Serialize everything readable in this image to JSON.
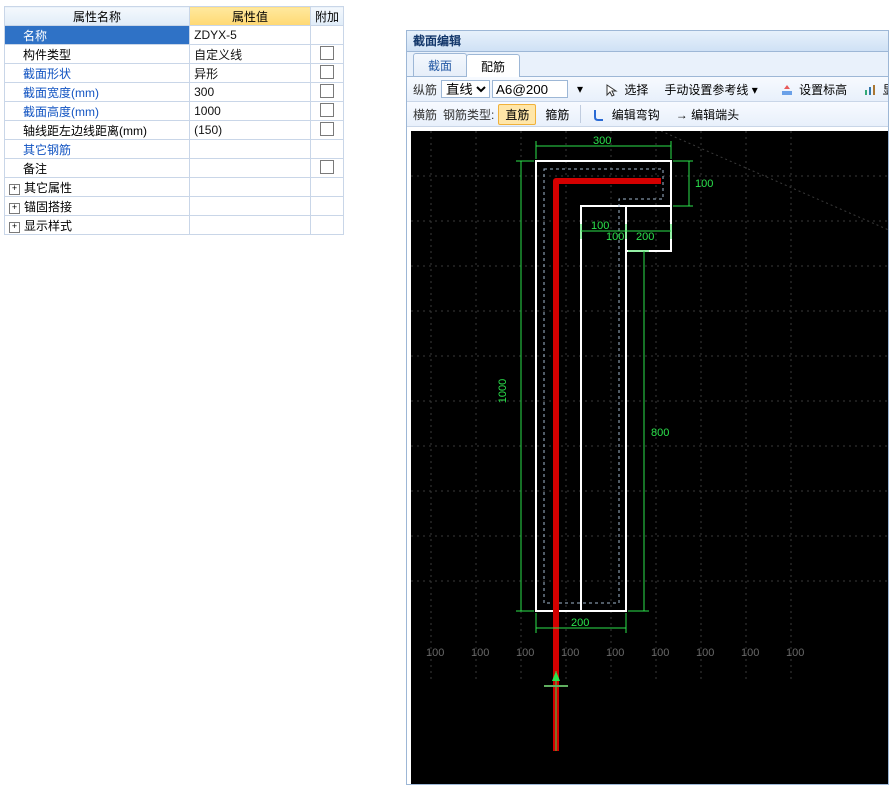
{
  "propgrid": {
    "headers": {
      "name": "属性名称",
      "value": "属性值",
      "extra": "附加"
    },
    "rows": [
      {
        "key": "name",
        "label": "名称",
        "value": "ZDYX-5",
        "selected": true,
        "extra": null
      },
      {
        "key": "type",
        "label": "构件类型",
        "value": "自定义线",
        "extra": "chk"
      },
      {
        "key": "shape",
        "label": "截面形状",
        "value": "异形",
        "blue": true,
        "extra": "chk"
      },
      {
        "key": "width",
        "label": "截面宽度(mm)",
        "value": "300",
        "blue": true,
        "extra": "chk"
      },
      {
        "key": "height",
        "label": "截面高度(mm)",
        "value": "1000",
        "blue": true,
        "extra": "chk"
      },
      {
        "key": "axis",
        "label": "轴线距左边线距离(mm)",
        "value": "(150)",
        "extra": "chk"
      },
      {
        "key": "other_rebar",
        "label": "其它钢筋",
        "value": "",
        "blue": true,
        "extra": null
      },
      {
        "key": "remark",
        "label": "备注",
        "value": "",
        "extra": "chk"
      },
      {
        "key": "exp1",
        "label": "其它属性",
        "value": "",
        "expander": true
      },
      {
        "key": "exp2",
        "label": "锚固搭接",
        "value": "",
        "expander": true
      },
      {
        "key": "exp3",
        "label": "显示样式",
        "value": "",
        "expander": true
      }
    ],
    "plus": "+"
  },
  "editor": {
    "title": "截面编辑",
    "tabs": {
      "section": "截面",
      "rebar": "配筋"
    },
    "toolbar1": {
      "label_v": "纵筋",
      "line_type": "直线",
      "spec": "A6@200",
      "select_btn": "选择",
      "manual_ref": "手动设置参考线",
      "set_elev": "设置标高",
      "show_label": "显示标"
    },
    "toolbar2": {
      "label_h": "横筋",
      "rebar_type_label": "钢筋类型:",
      "straight": "直筋",
      "stirrup": "箍筋",
      "edit_hook": "编辑弯钩",
      "edit_end": "编辑端头"
    }
  },
  "drawing": {
    "dims": {
      "top": "300",
      "h_all": "1000",
      "right_100": "100",
      "sm_100a": "100",
      "sm_100b": "100",
      "sm_200": "200",
      "right_800": "800",
      "bottom": "200"
    },
    "ruler": [
      "100",
      "100",
      "100",
      "100",
      "100",
      "100",
      "100",
      "100",
      "100"
    ]
  }
}
